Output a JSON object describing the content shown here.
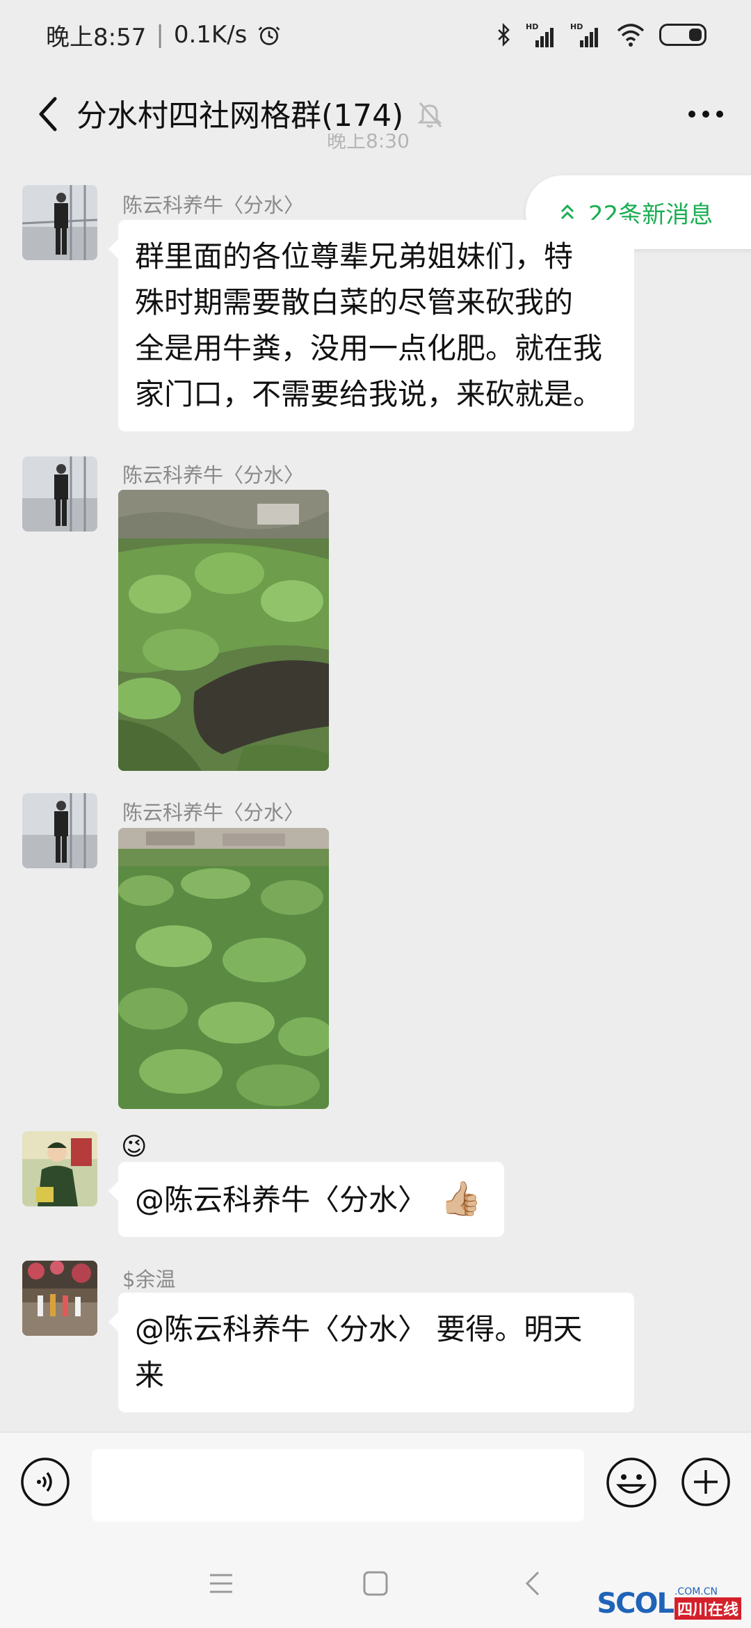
{
  "status_bar": {
    "time": "晚上8:57",
    "separator": "|",
    "speed": "0.1K/s",
    "alarm_icon": "alarm-icon",
    "bluetooth_icon": "bluetooth-icon",
    "signal_label": "HD",
    "wifi_icon": "wifi-icon",
    "battery_icon": "battery-icon"
  },
  "header": {
    "title": "分水村四社网格群(174)",
    "back_icon": "chevron-left-icon",
    "mute_icon": "bell-muted-icon",
    "more_icon": "more-dots-icon"
  },
  "timestamp_partial": "晚上8:30",
  "new_messages": {
    "label": "22条新消息",
    "icon": "double-chevron-up-icon",
    "accent": "#1aad52"
  },
  "messages": [
    {
      "sender": "陈云科养牛〈分水〉",
      "text_lines": [
        "群里面的各位尊辈兄弟姐妹们，特",
        "殊时期需要散白菜的尽管来砍我的",
        "全是用牛粪，没用一点化肥。就在我",
        "家门口，不需要给我说，来砍就是。"
      ]
    },
    {
      "sender": "陈云科养牛〈分水〉",
      "image": "photo of cabbage field with manure"
    },
    {
      "sender": "陈云科养牛〈分水〉",
      "image": "photo of cabbage field"
    },
    {
      "sender_emoji": "😉",
      "text": "@陈云科养牛〈分水〉",
      "emoji": "👍🏼"
    },
    {
      "sender": "$余温",
      "text_lines": [
        "@陈云科养牛〈分水〉 要得。明天",
        "来"
      ]
    }
  ],
  "input_bar": {
    "voice_icon": "voice-icon",
    "emoji_icon": "emoji-smile-icon",
    "plus_icon": "plus-circle-icon",
    "placeholder": ""
  },
  "system_nav": {
    "menu_icon": "menu-icon",
    "home_icon": "home-square-icon",
    "back_icon": "back-triangle-icon"
  },
  "watermark": {
    "logo": "SCOL",
    "domain": ".COM.CN",
    "chinese": "四川在线"
  }
}
